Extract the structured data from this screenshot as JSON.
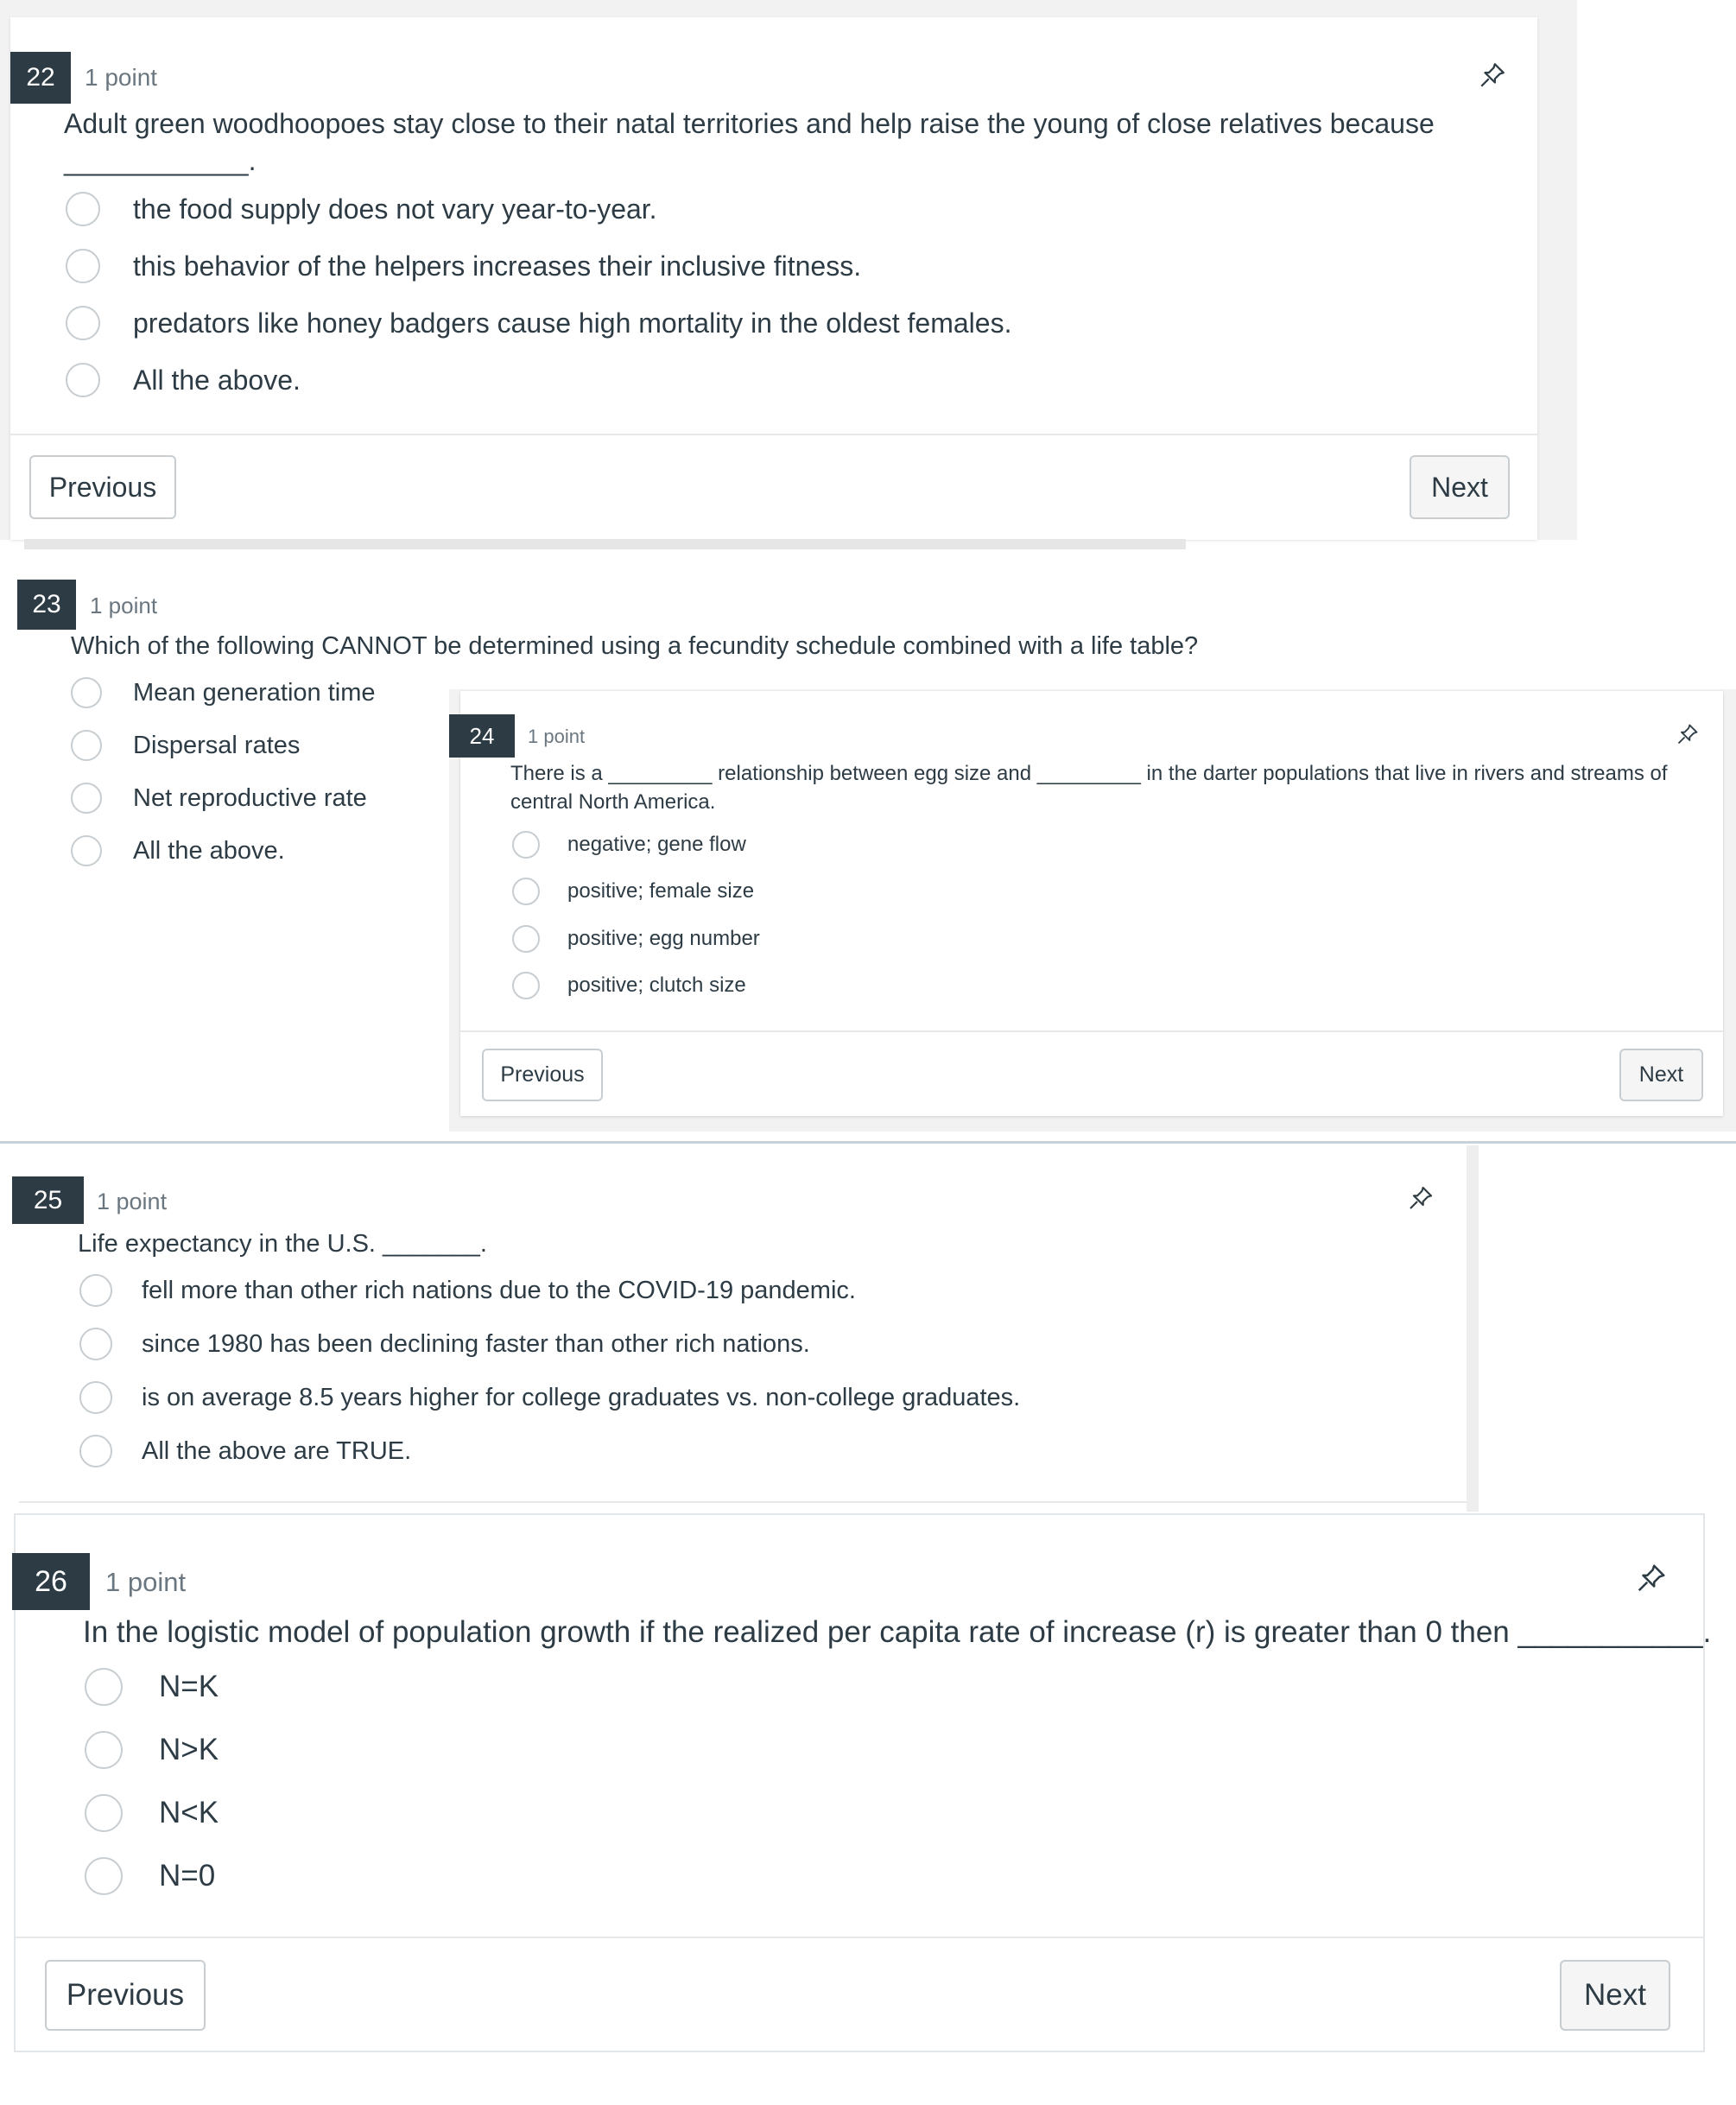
{
  "q22": {
    "number": "22",
    "points": "1 point",
    "text_line1": "Adult green woodhoopoes stay close to their natal territories and help raise the young of close relatives because",
    "text_line2": "____________.",
    "options": [
      "the food supply does not vary year-to-year.",
      "this behavior of the helpers increases their inclusive fitness.",
      "predators like honey badgers cause high mortality in the oldest females.",
      "All the above."
    ],
    "previous_label": "Previous",
    "next_label": "Next"
  },
  "q23": {
    "number": "23",
    "points": "1 point",
    "text": "Which of the following CANNOT be determined using a fecundity schedule combined with a life table?",
    "options": [
      "Mean generation time",
      "Dispersal rates",
      "Net reproductive rate",
      "All the above."
    ]
  },
  "q24": {
    "number": "24",
    "points": "1 point",
    "text_line1": "There is a _________ relationship between egg size and _________ in the darter populations that live in rivers and streams of",
    "text_line2": "central North America.",
    "options": [
      "negative; gene flow",
      "positive; female size",
      "positive; egg number",
      "positive; clutch size"
    ],
    "previous_label": "Previous",
    "next_label": "Next"
  },
  "q25": {
    "number": "25",
    "points": "1 point",
    "text": "Life expectancy in the U.S. _______.",
    "options": [
      "fell more than other rich nations due to the COVID-19 pandemic.",
      "since 1980 has been declining faster than other rich nations.",
      "is on average 8.5 years higher for college graduates vs. non-college graduates.",
      "All the above are TRUE."
    ]
  },
  "q26": {
    "number": "26",
    "points": "1 point",
    "text": "In the logistic model of population growth if the realized per capita rate of increase (r) is greater than 0 then ___________.",
    "options": [
      "N=K",
      "N>K",
      "N<K",
      "N=0"
    ],
    "previous_label": "Previous",
    "next_label": "Next"
  }
}
